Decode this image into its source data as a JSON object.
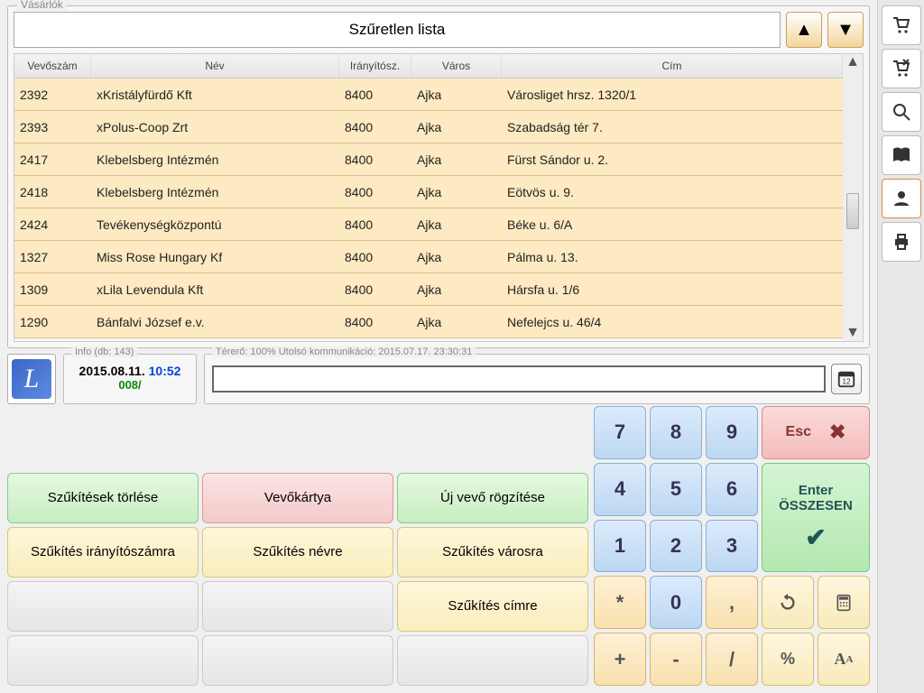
{
  "customers_legend": "Vásárlók",
  "filter_title": "Szűretlen lista",
  "columns": {
    "id": "Vevőszám",
    "name": "Név",
    "zip": "Irányítósz.",
    "city": "Város",
    "addr": "Cím"
  },
  "rows": [
    {
      "id": "2392",
      "name": "xKristályfürdő Kft",
      "zip": "8400",
      "city": "Ajka",
      "addr": "Városliget hrsz. 1320/1"
    },
    {
      "id": "2393",
      "name": "xPolus-Coop Zrt",
      "zip": "8400",
      "city": "Ajka",
      "addr": "Szabadság tér 7."
    },
    {
      "id": "2417",
      "name": "Klebelsberg Intézmén",
      "zip": "8400",
      "city": "Ajka",
      "addr": "Fürst Sándor u. 2."
    },
    {
      "id": "2418",
      "name": "Klebelsberg Intézmén",
      "zip": "8400",
      "city": "Ajka",
      "addr": "Eötvös u. 9."
    },
    {
      "id": "2424",
      "name": "Tevékenységközpontú",
      "zip": "8400",
      "city": "Ajka",
      "addr": "Béke u. 6/A"
    },
    {
      "id": "1327",
      "name": "Miss Rose Hungary Kf",
      "zip": "8400",
      "city": "Ajka",
      "addr": "Pálma u. 13."
    },
    {
      "id": "1309",
      "name": "xLila Levendula Kft",
      "zip": "8400",
      "city": "Ajka",
      "addr": "Hársfa u. 1/6"
    },
    {
      "id": "1290",
      "name": "Bánfalvi József e.v.",
      "zip": "8400",
      "city": "Ajka",
      "addr": "Nefelejcs u. 46/4"
    }
  ],
  "info_legend": "Info (db: 143)",
  "date": "2015.08.11.",
  "time": "10:52",
  "code": "008/",
  "signal_legend": "Térerő: 100%  Utolsó kommunikáció: 2015.07.17. 23:30:31",
  "buttons": {
    "clear_filters": "Szűkítések törlése",
    "customer_card": "Vevőkártya",
    "new_customer": "Új vevő rögzítése",
    "filter_zip": "Szűkítés irányítószámra",
    "filter_name": "Szűkítés névre",
    "filter_city": "Szűkítés városra",
    "filter_addr": "Szűkítés címre"
  },
  "keypad": {
    "n7": "7",
    "n8": "8",
    "n9": "9",
    "n4": "4",
    "n5": "5",
    "n6": "6",
    "n1": "1",
    "n2": "2",
    "n3": "3",
    "n0": "0",
    "star": "*",
    "comma": ",",
    "plus": "+",
    "minus": "-",
    "slash": "/",
    "percent": "%",
    "esc": "Esc",
    "enter_line1": "Enter",
    "enter_line2": "ÖSSZESEN",
    "undo": "↶",
    "calc": "▦",
    "font": "A"
  },
  "cal_day": "12"
}
